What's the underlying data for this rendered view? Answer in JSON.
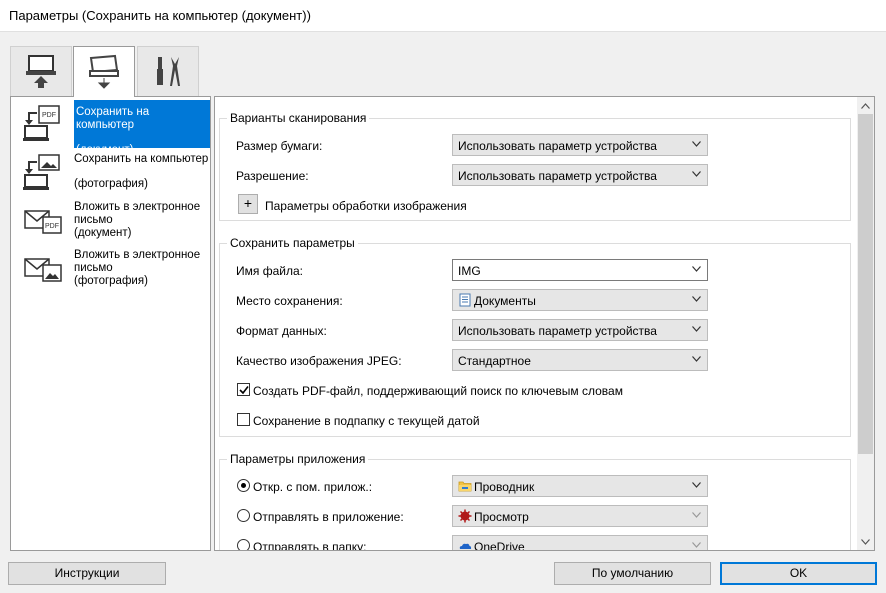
{
  "window": {
    "title": "Параметры (Сохранить на компьютер (документ))"
  },
  "tabs": [
    {
      "icon": "computer-upload-icon"
    },
    {
      "icon": "scanner-save-icon",
      "active": true
    },
    {
      "icon": "tools-icon"
    }
  ],
  "left_list": {
    "items": [
      {
        "line1": "Сохранить на компьютер",
        "line2": "(документ)",
        "icon": "pdf-to-computer-icon",
        "selected": true
      },
      {
        "line1": "Сохранить на компьютер",
        "line2": "(фотография)",
        "icon": "photo-to-computer-icon",
        "selected": false
      },
      {
        "line1": "Вложить в электронное",
        "line2": "письмо",
        "line3": "(документ)",
        "icon": "mail-pdf-icon",
        "selected": false
      },
      {
        "line1": "Вложить в электронное",
        "line2": "письмо",
        "line3": "(фотография)",
        "icon": "mail-photo-icon",
        "selected": false
      }
    ]
  },
  "scan_options": {
    "title": "Варианты сканирования",
    "paper_size": {
      "label": "Размер бумаги:",
      "value": "Использовать параметр устройства"
    },
    "resolution": {
      "label": "Разрешение:",
      "value": "Использовать параметр устройства"
    },
    "image_processing": {
      "button": "+",
      "label": "Параметры обработки изображения"
    }
  },
  "save_options": {
    "title": "Сохранить параметры",
    "file_name": {
      "label": "Имя файла:",
      "value": "IMG"
    },
    "save_location": {
      "label": "Место сохранения:",
      "value": "Документы",
      "icon": "documents-folder-icon"
    },
    "data_format": {
      "label": "Формат данных:",
      "value": "Использовать параметр устройства"
    },
    "jpeg_quality": {
      "label": "Качество изображения JPEG:",
      "value": "Стандартное"
    },
    "searchable_pdf": {
      "label": "Создать PDF-файл, поддерживающий поиск по ключевым словам",
      "checked": true
    },
    "date_subfolder": {
      "label": "Сохранение в подпапку с текущей датой",
      "checked": false
    }
  },
  "app_options": {
    "title": "Параметры приложения",
    "open_with": {
      "label": "Откр. с пом. прилож.:",
      "value": "Проводник",
      "selected": true,
      "icon": "explorer-folder-icon"
    },
    "send_to_app": {
      "label": "Отправлять в приложение:",
      "value": "Просмотр",
      "selected": false,
      "icon": "viewer-app-icon"
    },
    "send_to_folder": {
      "label": "Отправлять в папку:",
      "value": "OneDrive",
      "selected": false,
      "icon": "onedrive-icon"
    }
  },
  "buttons": {
    "instructions": "Инструкции",
    "defaults": "По умолчанию",
    "ok": "OK"
  },
  "colors": {
    "selection": "#0078d7",
    "accent": "#0078d7"
  }
}
